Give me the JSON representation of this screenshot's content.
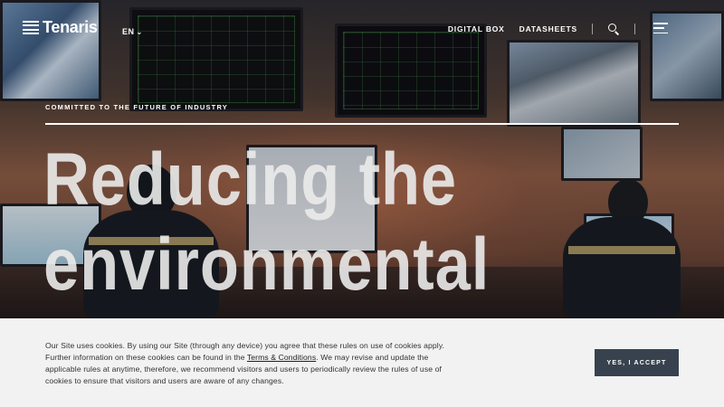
{
  "header": {
    "logo_text": "Tenaris",
    "language": "EN",
    "nav": [
      {
        "label": "DIGITAL BOX"
      },
      {
        "label": "DATASHEETS"
      }
    ],
    "icons": [
      "search-icon",
      "menu-icon",
      "chevron-down-icon"
    ]
  },
  "hero": {
    "eyebrow": "COMMITTED TO THE FUTURE OF INDUSTRY",
    "headline_line1": "Reducing the",
    "headline_line2": "environmental"
  },
  "cookie_banner": {
    "text_before": "Our Site uses cookies. By using our Site (through any device) you agree that these rules on use of cookies apply. Further information on these cookies can be found in the ",
    "link": "Terms & Conditions",
    "text_after": ".  We may revise and update the applicable rules at anytime, therefore, we recommend visitors and users to periodically review the rules of use of cookies to ensure that visitors and users are aware of any changes.",
    "accept_label": "YES, I ACCEPT"
  },
  "colors": {
    "banner_bg": "#f2f2f2",
    "accept_bg": "#37424e",
    "text": "#333333"
  }
}
